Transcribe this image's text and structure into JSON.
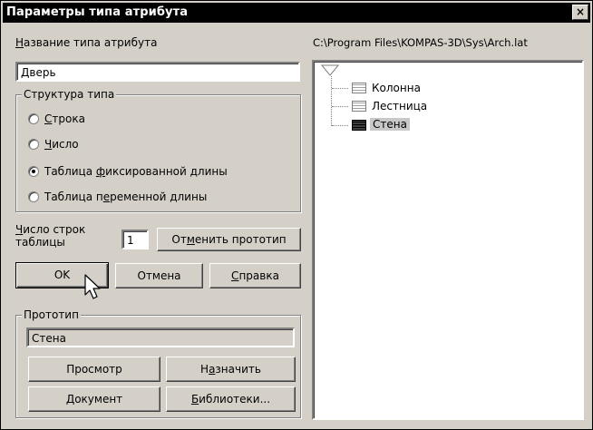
{
  "window": {
    "title": "Параметры типа атрибута",
    "close_glyph": "×"
  },
  "name_field": {
    "label_u": "Н",
    "label_rest": "азвание типа атрибута",
    "value": "Дверь"
  },
  "structure": {
    "label": "Структура типа",
    "options": [
      {
        "pre": "",
        "u": "С",
        "post": "трока",
        "selected": false
      },
      {
        "pre": "",
        "u": "Ч",
        "post": "исло",
        "selected": false
      },
      {
        "pre": "Таблица ",
        "u": "ф",
        "post": "иксированной длины",
        "selected": true
      },
      {
        "pre": "Таблица п",
        "u": "е",
        "post": "ременной длины",
        "selected": false
      }
    ]
  },
  "rows": {
    "label_u": "Ч",
    "label_rest": "исло строк",
    "label_line2": "таблицы",
    "value": "1"
  },
  "cancel_prototype_button": {
    "pre": "От",
    "u": "м",
    "post": "енить прототип"
  },
  "buttons": {
    "ok": "OK",
    "cancel": "Отмена",
    "help_u": "С",
    "help_rest": "правка"
  },
  "prototype": {
    "label": "Прототип",
    "value": "Стена",
    "view": "Просмотр",
    "assign_pre": "Н",
    "assign_u": "а",
    "assign_post": "значить",
    "document_u": "Д",
    "document_rest": "окумент",
    "library_u": "Б",
    "library_rest": "иблиотеки..."
  },
  "library_path": "C:\\Program Files\\KOMPAS-3D\\Sys\\Arch.lat",
  "tree": {
    "items": [
      {
        "label": "Колонна",
        "selected": false
      },
      {
        "label": "Лестница",
        "selected": false
      },
      {
        "label": "Стена",
        "selected": true
      }
    ]
  }
}
